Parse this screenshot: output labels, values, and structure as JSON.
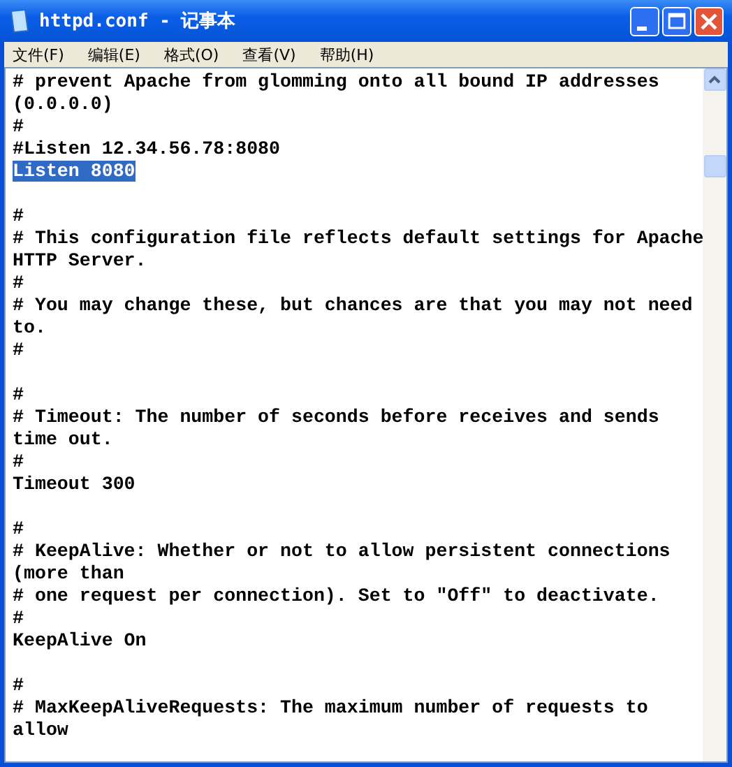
{
  "window": {
    "title": "httpd.conf - 记事本"
  },
  "menu": [
    {
      "label": "文件(F)"
    },
    {
      "label": "编辑(E)"
    },
    {
      "label": "格式(O)"
    },
    {
      "label": "查看(V)"
    },
    {
      "label": "帮助(H)"
    }
  ],
  "lines": [
    {
      "kind": "text",
      "text": "# prevent Apache from glomming onto all bound IP addresses",
      "selected": false
    },
    {
      "kind": "text",
      "text": "(0.0.0.0)",
      "selected": false
    },
    {
      "kind": "text",
      "text": "#",
      "selected": false
    },
    {
      "kind": "text",
      "text": "#Listen 12.34.56.78:8080",
      "selected": false
    },
    {
      "kind": "text",
      "text": "Listen 8080",
      "selected": true
    },
    {
      "kind": "blank"
    },
    {
      "kind": "text",
      "text": "#",
      "selected": false
    },
    {
      "kind": "text",
      "text": "# This configuration file reflects default settings for Apache",
      "selected": false
    },
    {
      "kind": "text",
      "text": "HTTP Server.",
      "selected": false
    },
    {
      "kind": "text",
      "text": "#",
      "selected": false
    },
    {
      "kind": "text",
      "text": "# You may change these, but chances are that you may not need",
      "selected": false
    },
    {
      "kind": "text",
      "text": "to.",
      "selected": false
    },
    {
      "kind": "text",
      "text": "#",
      "selected": false
    },
    {
      "kind": "blank"
    },
    {
      "kind": "text",
      "text": "#",
      "selected": false
    },
    {
      "kind": "text",
      "text": "# Timeout: The number of seconds before receives and sends",
      "selected": false
    },
    {
      "kind": "text",
      "text": "time out.",
      "selected": false
    },
    {
      "kind": "text",
      "text": "#",
      "selected": false
    },
    {
      "kind": "text",
      "text": "Timeout 300",
      "selected": false
    },
    {
      "kind": "blank"
    },
    {
      "kind": "text",
      "text": "#",
      "selected": false
    },
    {
      "kind": "text",
      "text": "# KeepAlive: Whether or not to allow persistent connections",
      "selected": false
    },
    {
      "kind": "text",
      "text": "(more than",
      "selected": false
    },
    {
      "kind": "text",
      "text": "# one request per connection). Set to \"Off\" to deactivate.",
      "selected": false
    },
    {
      "kind": "text",
      "text": "#",
      "selected": false
    },
    {
      "kind": "text",
      "text": "KeepAlive On",
      "selected": false
    },
    {
      "kind": "blank"
    },
    {
      "kind": "text",
      "text": "#",
      "selected": false
    },
    {
      "kind": "text",
      "text": "# MaxKeepAliveRequests: The maximum number of requests to",
      "selected": false
    },
    {
      "kind": "text",
      "text": "allow",
      "selected": false
    }
  ]
}
